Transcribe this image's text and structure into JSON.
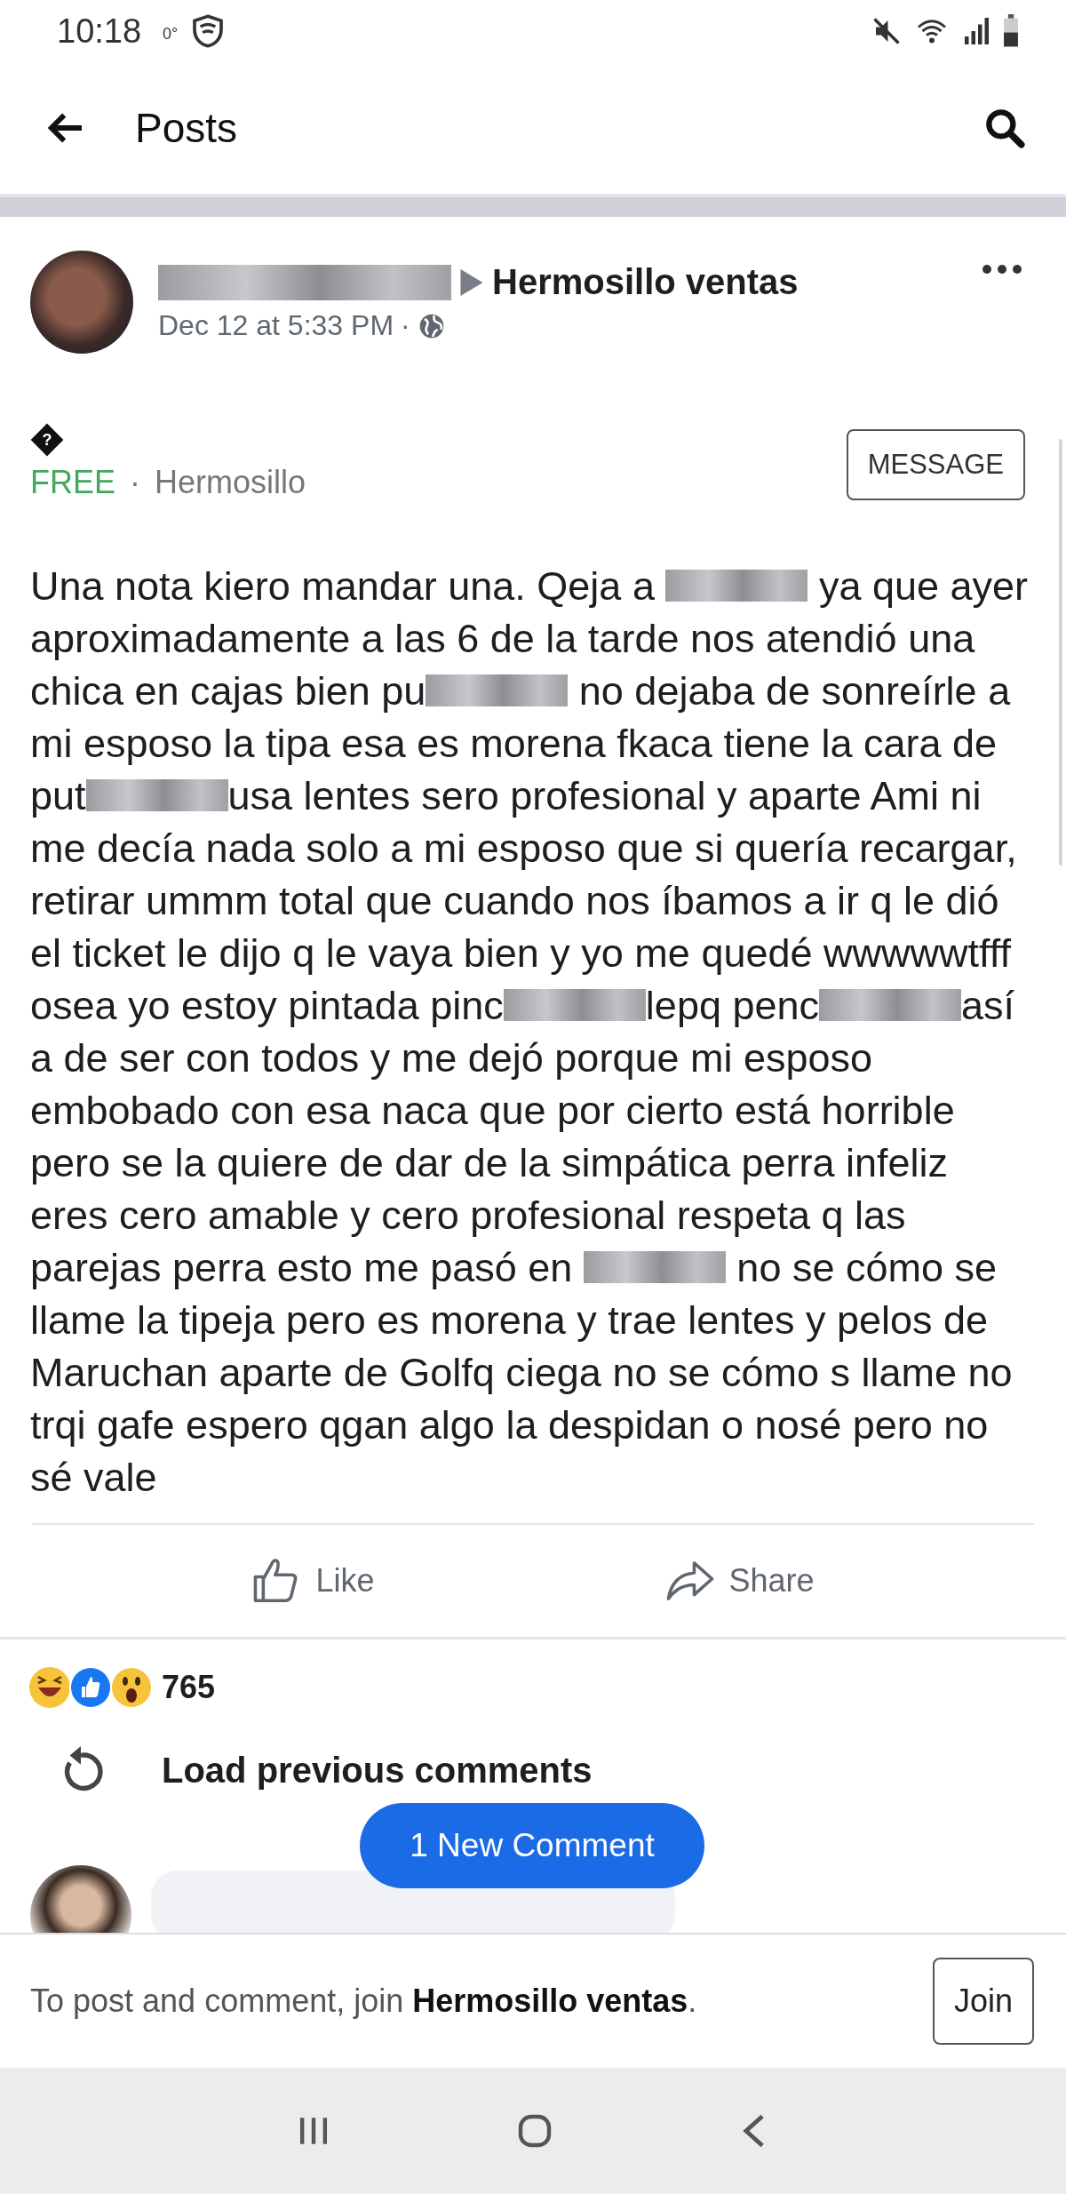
{
  "status_bar": {
    "time": "10:18",
    "temperature": "0°"
  },
  "app_bar": {
    "title": "Posts"
  },
  "post": {
    "group": "Hermosillo ventas",
    "time": "Dec 12 at 5:33 PM",
    "time_separator": "·",
    "symbol": "?",
    "price": "FREE",
    "location_separator": "·",
    "location": "Hermosillo",
    "message_button": "MESSAGE",
    "body": [
      {
        "kind": "text",
        "text": "Una nota kiero mandar una. Qeja a "
      },
      {
        "kind": "redacted"
      },
      {
        "kind": "text",
        "text": " ya que ayer aproximadamente a las 6 de la tarde nos atendió una chica en cajas bien pu"
      },
      {
        "kind": "redacted"
      },
      {
        "kind": "text",
        "text": " no dejaba de sonreírle a mi esposo la tipa esa es morena fkaca tiene la cara de put"
      },
      {
        "kind": "redacted"
      },
      {
        "kind": "text",
        "text": "usa lentes sero profesional y aparte Ami ni me decía nada solo a mi esposo que si quería recargar, retirar   ummm total que cuando nos íbamos a ir q le dió el ticket le dijo q le vaya bien y yo me quedé wwwwwtfff osea yo estoy pintada pinc"
      },
      {
        "kind": "redacted"
      },
      {
        "kind": "text",
        "text": "lepq penc"
      },
      {
        "kind": "redacted"
      },
      {
        "kind": "text",
        "text": "así a de ser con todos y me dejó porque mi esposo embobado con esa naca que por cierto está horrible pero se la quiere de dar de la simpática perra infeliz eres cero amable y cero profesional respeta q las parejas perra esto me pasó en "
      },
      {
        "kind": "redacted"
      },
      {
        "kind": "text",
        "text": " no se cómo se llame la tipeja pero es morena y trae lentes y pelos de Maruchan aparte de Golfq ciega no se cómo s llame no trqi gafe espero qgan algo la despidan o nosé pero no sé vale"
      }
    ],
    "actions": [
      {
        "kind": "like",
        "label": "Like"
      },
      {
        "kind": "share",
        "label": "Share"
      }
    ],
    "reaction_count": "765",
    "load_previous": "Load previous comments",
    "new_comment_pill": "1 New Comment"
  },
  "join_bar": {
    "text_before": "To post and comment, join ",
    "group": "Hermosillo ventas",
    "text_after": ".",
    "button": "Join"
  }
}
